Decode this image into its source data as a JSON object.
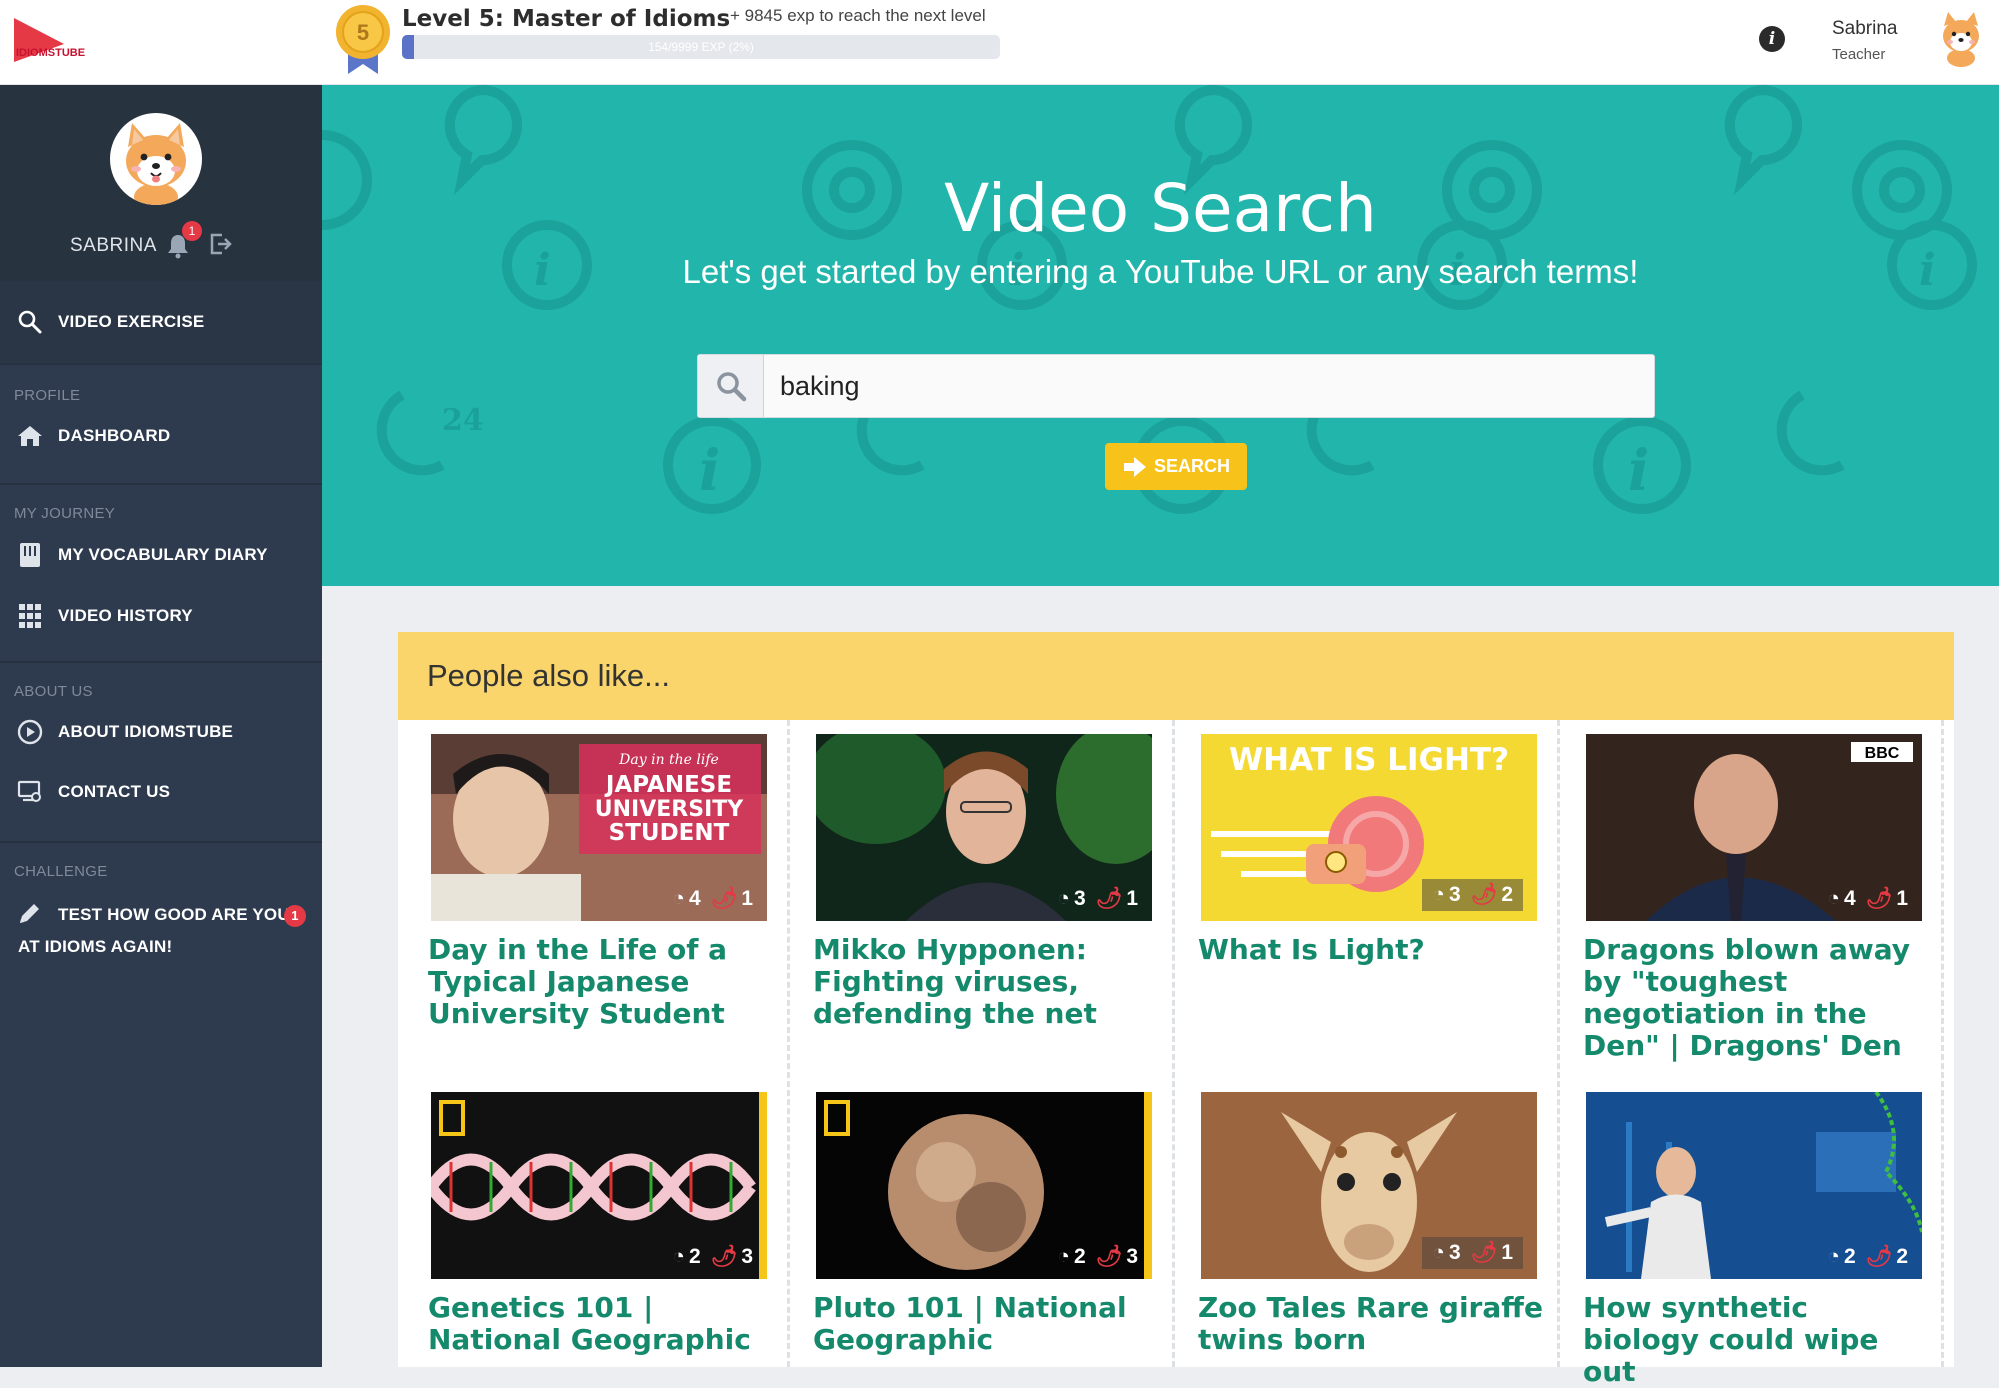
{
  "app": {
    "logo_text": "IDIOMSTUBE"
  },
  "level": {
    "badge_number": "5",
    "title": "Level 5: Master of Idioms",
    "next_level_text": "+ 9845 exp to reach the next level",
    "progress_text": "154/9999 EXP (2%)",
    "progress_fraction": 0.02
  },
  "user": {
    "name": "Sabrina",
    "role": "Teacher",
    "sidebar_name": "SABRINA",
    "notification_count": "1"
  },
  "sidebar": {
    "video_exercise": "VIDEO EXERCISE",
    "section_profile": "PROFILE",
    "dashboard": "DASHBOARD",
    "section_journey": "MY JOURNEY",
    "vocabulary_diary": "MY VOCABULARY DIARY",
    "video_history": "VIDEO HISTORY",
    "section_about": "ABOUT US",
    "about_idiomstube": "ABOUT IDIOMSTUBE",
    "contact_us": "CONTACT US",
    "section_challenge": "CHALLENGE",
    "challenge_line1": "TEST HOW GOOD ARE YOU",
    "challenge_line2": "AT IDIOMS AGAIN!",
    "challenge_badge": "1"
  },
  "hero": {
    "title": "Video Search",
    "subtitle": "Let's get started by entering a YouTube URL or any search terms!",
    "search_value": "baking",
    "search_button": "SEARCH"
  },
  "recommendations": {
    "heading": "People also like...",
    "videos": [
      {
        "title": "Day in the Life of a Typical Japanese University Student",
        "difficulty": "4",
        "spice": "1",
        "thumb_text": "JAPANESE UNIVERSITY STUDENT",
        "thumb_script": "Day in the life"
      },
      {
        "title": "Mikko Hypponen: Fighting viruses, defending the net",
        "difficulty": "3",
        "spice": "1"
      },
      {
        "title": "What Is Light?",
        "difficulty": "3",
        "spice": "2",
        "thumb_text": "WHAT IS LIGHT?"
      },
      {
        "title": "Dragons blown away by \"toughest negotiation in the Den\" | Dragons' Den",
        "difficulty": "4",
        "spice": "1",
        "thumb_text": "BBC"
      },
      {
        "title": "Genetics 101 | National Geographic",
        "difficulty": "2",
        "spice": "3"
      },
      {
        "title": "Pluto 101 | National Geographic",
        "difficulty": "2",
        "spice": "3"
      },
      {
        "title": "Zoo Tales Rare giraffe twins born",
        "difficulty": "3",
        "spice": "1"
      },
      {
        "title": "How synthetic biology could wipe out",
        "difficulty": "2",
        "spice": "2"
      }
    ]
  },
  "colors": {
    "teal": "#22b5ac",
    "sidebar": "#2e3b4e",
    "yellow_header": "#f9d56b",
    "title_green": "#15896b",
    "search_button": "#f7c31a",
    "badge_red": "#e53945"
  },
  "icons": [
    "search-icon",
    "home-icon",
    "diary-icon",
    "grid-icon",
    "play-circle-icon",
    "contact-icon",
    "pencil-icon",
    "bell-icon",
    "logout-icon",
    "info-icon",
    "speedometer-icon",
    "chili-icon"
  ]
}
